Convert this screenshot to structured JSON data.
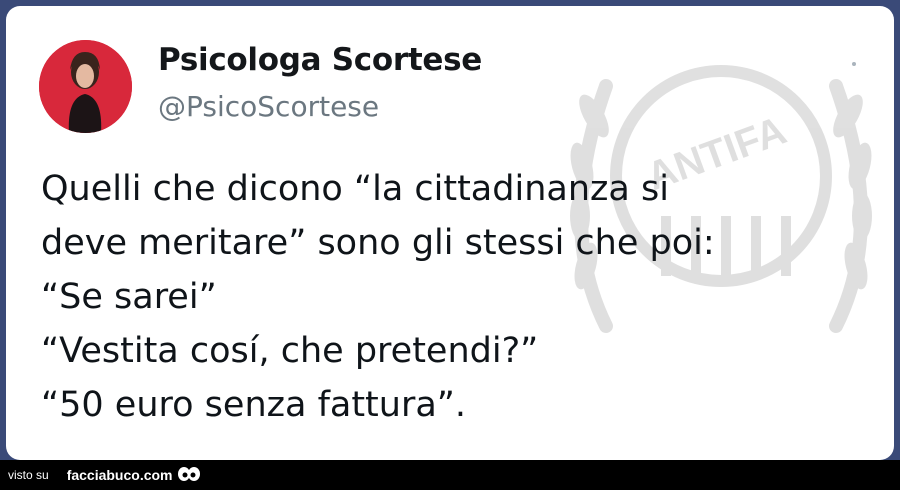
{
  "tweet": {
    "display_name": "Psicologa Scortese",
    "handle": "@PsicoScortese",
    "lines": [
      "Quelli che dicono “la cittadinanza si",
      "deve meritare” sono gli stessi che poi:",
      "“Se sarei”",
      "“Vestita cosí, che pretendi?”",
      "“50 euro senza fattura”."
    ]
  },
  "watermark": {
    "text": "ANTIFA"
  },
  "footer": {
    "visto_label": "visto su",
    "site_label": "facciabuco.com"
  },
  "colors": {
    "background": "#3a4a78",
    "card": "#ffffff",
    "avatar_bg": "#d8283b",
    "text": "#0f1419",
    "handle": "#6b7780"
  }
}
